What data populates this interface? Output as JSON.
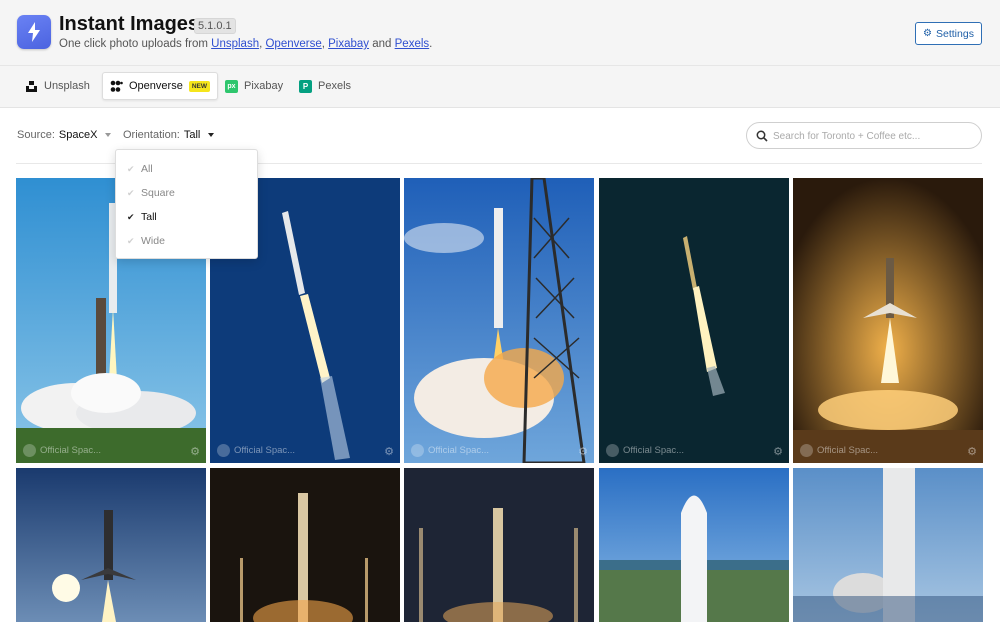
{
  "app": {
    "title": "Instant Images",
    "version": "5.1.0.1",
    "tagline_prefix": "One click photo uploads from ",
    "providers": [
      "Unsplash",
      "Openverse",
      "Pixabay",
      "Pexels"
    ],
    "tagline_sep1": ", ",
    "tagline_sep2": ", ",
    "tagline_and": " and ",
    "tagline_end": ".",
    "settings_label": "Settings"
  },
  "tabs": [
    {
      "label": "Unsplash",
      "icon": "unsplash-icon"
    },
    {
      "label": "Openverse",
      "icon": "openverse-icon",
      "badge": "NEW"
    },
    {
      "label": "Pixabay",
      "icon": "pixabay-icon",
      "icon_text": "px"
    },
    {
      "label": "Pexels",
      "icon": "pexels-icon",
      "icon_text": "P"
    }
  ],
  "filters": {
    "source_label": "Source:",
    "source_value": "SpaceX",
    "orientation_label": "Orientation:",
    "orientation_value": "Tall"
  },
  "search": {
    "placeholder": "Search for Toronto + Coffee etc..."
  },
  "orientation_options": [
    {
      "label": "All",
      "selected": false
    },
    {
      "label": "Square",
      "selected": false
    },
    {
      "label": "Tall",
      "selected": true
    },
    {
      "label": "Wide",
      "selected": false
    }
  ],
  "photos": [
    {
      "author": "Official Spac...",
      "scene": "launch-pad-blue-sky"
    },
    {
      "author": "Official Spac...",
      "scene": "rocket-ascent-dark-blue"
    },
    {
      "author": "Official Spac...",
      "scene": "launch-tower-clouds"
    },
    {
      "author": "Official Spac...",
      "scene": "night-ascent"
    },
    {
      "author": "Official Spac...",
      "scene": "booster-landing-fire"
    },
    {
      "author": "",
      "scene": "booster-landing-haze"
    },
    {
      "author": "",
      "scene": "night-pad-lights"
    },
    {
      "author": "",
      "scene": "night-pad-tower"
    },
    {
      "author": "",
      "scene": "fairing-aerial"
    },
    {
      "author": "",
      "scene": "rocket-side-spacex"
    }
  ],
  "colors": {
    "accent": "#2f6fb5",
    "logo": "#5a73ea",
    "badge": "#f5e51c",
    "pixabay": "#2ec66d",
    "pexels": "#05a081"
  }
}
